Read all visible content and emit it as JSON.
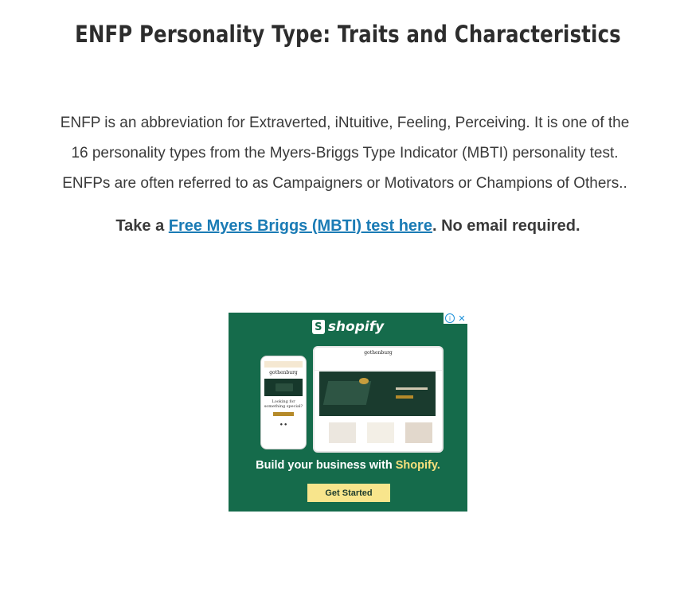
{
  "article": {
    "title": "ENFP Personality Type: Traits and Characteristics",
    "intro_lines": [
      "ENFP is an abbreviation for Extraverted, iNtuitive, Feeling, Perceiving. It is one of the",
      "16 personality types from the Myers-Briggs Type Indicator (MBTI) personality test.",
      "ENFPs are often referred to as Campaigners or Motivators or Champions of Others.."
    ],
    "cta_prefix": "Take a ",
    "cta_link": "Free Myers Briggs (MBTI) test here",
    "cta_suffix": ". No email required."
  },
  "ad": {
    "brand": "shopify",
    "brand_letter": "S",
    "mock_store": "gothenburg",
    "phone_text": "Looking for something special?",
    "tagline_prefix": "Build your business with ",
    "tagline_highlight": "Shopify.",
    "button": "Get Started",
    "adchoices_icon": "i",
    "close_icon": "✕",
    "colors": {
      "background": "#156b4b",
      "highlight": "#f7e07c",
      "button": "#f8e58c",
      "link": "#1a7bb5"
    }
  }
}
